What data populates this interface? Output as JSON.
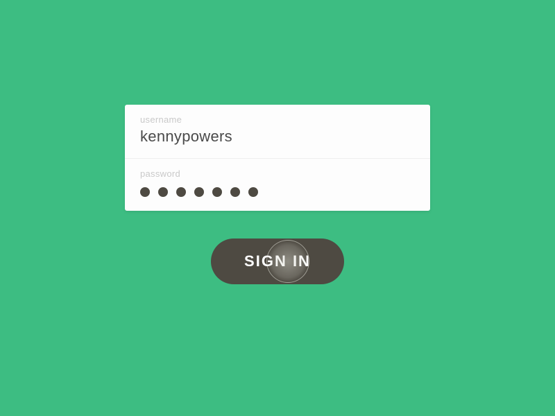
{
  "form": {
    "username_label": "username",
    "username_value": "kennypowers",
    "password_label": "password",
    "password_dot_count": 7
  },
  "actions": {
    "signin_label": "SIGN IN"
  },
  "colors": {
    "background": "#3dbd82",
    "card": "#fdfdfd",
    "button": "#4e4a42"
  }
}
